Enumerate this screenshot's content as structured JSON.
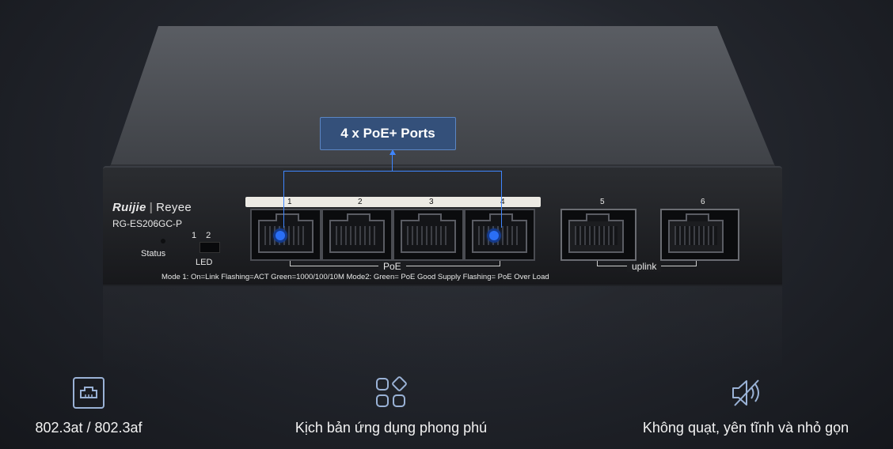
{
  "device": {
    "brand": "Ruijie",
    "brand_sub": "Reyee",
    "model": "RG-ES206GC-P",
    "status_label": "Status",
    "led_label": "LED",
    "led_modes": [
      "1",
      "2"
    ],
    "port_numbers": [
      "1",
      "2",
      "3",
      "4",
      "5",
      "6"
    ],
    "poe_group_label": "PoE",
    "uplink_group_label": "uplink",
    "mode_text": "Mode 1:  On=Link  Flashing=ACT   Green=1000/100/10M        Mode2:  Green= PoE Good Supply   Flashing= PoE Over Load"
  },
  "callout": {
    "label": "4 x PoE+ Ports",
    "highlighted_ports": [
      "1",
      "4"
    ],
    "accent_color": "#3f86ff"
  },
  "features": [
    {
      "icon": "ethernet-port-icon",
      "label": "802.3at / 802.3af"
    },
    {
      "icon": "apps-grid-icon",
      "label": "Kịch bản ứng dụng phong phú"
    },
    {
      "icon": "fan-off-icon",
      "label": "Không quạt, yên tĩnh và nhỏ gọn"
    }
  ]
}
